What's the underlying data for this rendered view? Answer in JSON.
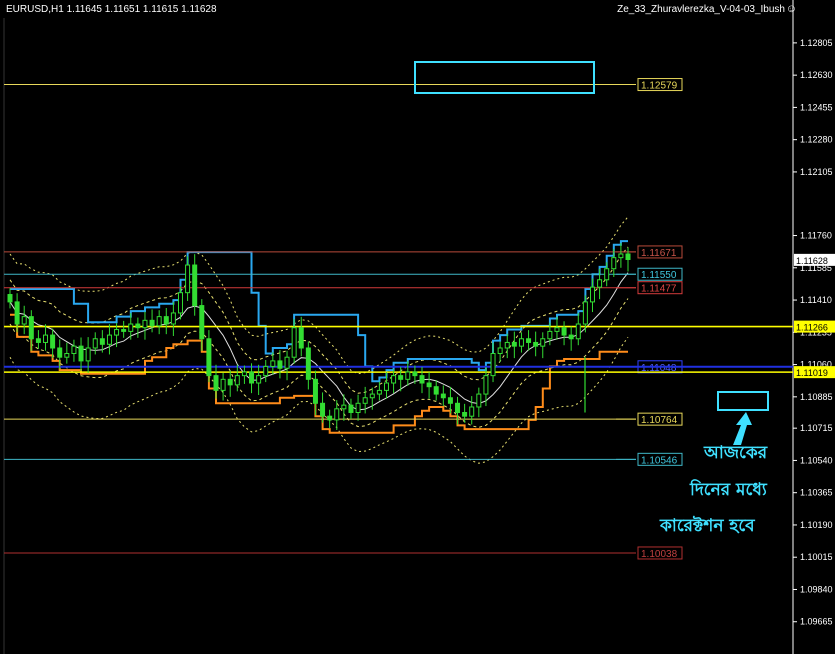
{
  "header": {
    "symbol_info": "EURUSD,H1  1.11645 1.11651 1.11615 1.11628",
    "indicator_name": "Ze_33_Zhuravlerezka_V-04-03_Ibush"
  },
  "annotation": {
    "line1": "আজকের",
    "line2": "দিনের মধ্যে",
    "line3": "কারেক্টশন হবে"
  },
  "chart_data": {
    "type": "candlestick",
    "instrument": "EURUSD",
    "timeframe": "H1",
    "ohlc_current": {
      "open": 1.11645,
      "high": 1.11651,
      "low": 1.11615,
      "close": 1.11628
    },
    "ylim": [
      1.0949,
      1.1294
    ],
    "y_ticks": [
      "1.12805",
      "1.12630",
      "1.12455",
      "1.12280",
      "1.12105",
      "1.11760",
      "1.11585",
      "1.11410",
      "1.11235",
      "1.11060",
      "1.10885",
      "1.10715",
      "1.10540",
      "1.10365",
      "1.10190",
      "1.10015",
      "1.09840",
      "1.09665"
    ],
    "current_price_label": "1.11628",
    "levels": [
      {
        "label": "1.12579",
        "value": 1.12579,
        "color": "#e8d85a",
        "box": "#e8d85a",
        "text": "#e8d85a"
      },
      {
        "label": "1.11671",
        "value": 1.11671,
        "color": "#b84a3a",
        "box": "#b84a3a",
        "text": "#c9554a"
      },
      {
        "label": "1.11550",
        "value": 1.1155,
        "color": "#3fb8c8",
        "box": "#3fb8c8",
        "text": "#3fc8e0"
      },
      {
        "label": "1.11477",
        "value": 1.11477,
        "color": "#d33b3b",
        "box": "#d33b3b",
        "text": "#e04545"
      },
      {
        "label": "1.11048",
        "value": 1.11048,
        "color": "#2030e0",
        "box": "#3040ff",
        "text": "#5060ff"
      },
      {
        "label": "1.10764",
        "value": 1.10764,
        "color": "#e8d85a",
        "box": "#e8d85a",
        "text": "#e8d85a"
      },
      {
        "label": "1.10546",
        "value": 1.10546,
        "color": "#3fb8c8",
        "box": "#3fb8c8",
        "text": "#3fc8e0"
      },
      {
        "label": "1.10038",
        "value": 1.10038,
        "color": "#b03030",
        "box": "#b03030",
        "text": "#c04040"
      }
    ],
    "horizontal_lines_axis": [
      {
        "label": "1.11266",
        "value": 1.11266,
        "color": "#ffff00"
      },
      {
        "label": "1.11019",
        "value": 1.11019,
        "color": "#ffff00"
      }
    ],
    "close_series": [
      1.114,
      1.1128,
      1.1132,
      1.112,
      1.1118,
      1.1122,
      1.1115,
      1.111,
      1.1112,
      1.1116,
      1.1108,
      1.1115,
      1.112,
      1.1117,
      1.1122,
      1.1125,
      1.1124,
      1.1128,
      1.1126,
      1.113,
      1.1127,
      1.1132,
      1.1128,
      1.1134,
      1.1145,
      1.116,
      1.1138,
      1.112,
      1.11,
      1.1092,
      1.1098,
      1.1095,
      1.11,
      1.1102,
      1.1096,
      1.11,
      1.1105,
      1.1108,
      1.1104,
      1.111,
      1.1126,
      1.1115,
      1.1098,
      1.1085,
      1.1078,
      1.1076,
      1.1082,
      1.1084,
      1.108,
      1.1085,
      1.1088,
      1.109,
      1.1092,
      1.1096,
      1.11,
      1.1098,
      1.1102,
      1.11,
      1.1096,
      1.1094,
      1.109,
      1.1088,
      1.1085,
      1.108,
      1.1078,
      1.1083,
      1.109,
      1.11,
      1.1112,
      1.1115,
      1.1118,
      1.1116,
      1.112,
      1.1118,
      1.1116,
      1.112,
      1.1124,
      1.1126,
      1.1122,
      1.112,
      1.1128,
      1.114,
      1.1148,
      1.1152,
      1.1158,
      1.1164,
      1.1166,
      1.1163
    ],
    "colors": {
      "candle": "#33dd33",
      "background": "#000000",
      "axis_text": "#ffffff",
      "orange_channel": "#ff8c1a",
      "blue_channel": "#2aa8f0",
      "envelope": "#e8e070",
      "annotation": "#3fe0ff"
    }
  }
}
